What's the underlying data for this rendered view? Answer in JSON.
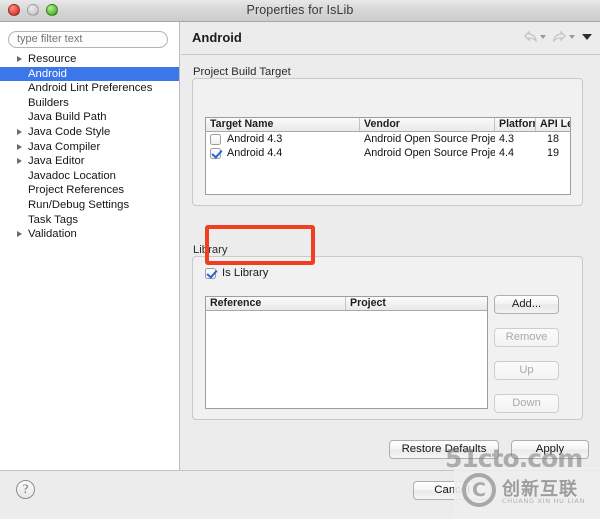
{
  "window": {
    "title": "Properties for IsLib",
    "controls": {
      "close": "close-button",
      "minimize": "minimize-button",
      "zoom": "zoom-button"
    }
  },
  "sidebar": {
    "filter": {
      "value": "",
      "placeholder": "type filter text"
    },
    "items": [
      {
        "label": "Resource",
        "expandable": true,
        "selected": false
      },
      {
        "label": "Android",
        "expandable": false,
        "selected": true
      },
      {
        "label": "Android Lint Preferences",
        "expandable": false,
        "selected": false
      },
      {
        "label": "Builders",
        "expandable": false,
        "selected": false
      },
      {
        "label": "Java Build Path",
        "expandable": false,
        "selected": false
      },
      {
        "label": "Java Code Style",
        "expandable": true,
        "selected": false
      },
      {
        "label": "Java Compiler",
        "expandable": true,
        "selected": false
      },
      {
        "label": "Java Editor",
        "expandable": true,
        "selected": false
      },
      {
        "label": "Javadoc Location",
        "expandable": false,
        "selected": false
      },
      {
        "label": "Project References",
        "expandable": false,
        "selected": false
      },
      {
        "label": "Run/Debug Settings",
        "expandable": false,
        "selected": false
      },
      {
        "label": "Task Tags",
        "expandable": false,
        "selected": false
      },
      {
        "label": "Validation",
        "expandable": true,
        "selected": false
      }
    ]
  },
  "page": {
    "title": "Android",
    "nav": {
      "back": "back-arrow-icon",
      "back_menu": "chevron-down-icon",
      "forward": "forward-arrow-icon",
      "forward_menu": "chevron-down-icon",
      "view_menu": "chevron-down-icon"
    }
  },
  "build_target": {
    "group_label": "Project Build Target",
    "columns": [
      "Target Name",
      "Vendor",
      "Platform",
      "API Le"
    ],
    "rows": [
      {
        "checked": false,
        "name": "Android 4.3",
        "vendor": "Android Open Source Project",
        "platform": "4.3",
        "api": "18"
      },
      {
        "checked": true,
        "name": "Android 4.4",
        "vendor": "Android Open Source Project",
        "platform": "4.4",
        "api": "19"
      }
    ]
  },
  "library": {
    "group_label": "Library",
    "is_library": {
      "label": "Is Library",
      "checked": true
    },
    "columns": [
      "Reference",
      "Project"
    ],
    "rows": [],
    "buttons": [
      {
        "label": "Add...",
        "enabled": true
      },
      {
        "label": "Remove",
        "enabled": false
      },
      {
        "label": "Up",
        "enabled": false
      },
      {
        "label": "Down",
        "enabled": false
      }
    ]
  },
  "footer": {
    "restore_defaults": "Restore Defaults",
    "apply": "Apply",
    "cancel": "Cancel",
    "help": "?"
  },
  "annotation": {
    "color": "#ef3e20",
    "target": "is-library-checkbox"
  },
  "watermark": {
    "top_text": "51cto.com",
    "logo_glyph": "C",
    "chinese": "创新互联",
    "pinyin": "CHUANG XIN HU LIAN"
  }
}
